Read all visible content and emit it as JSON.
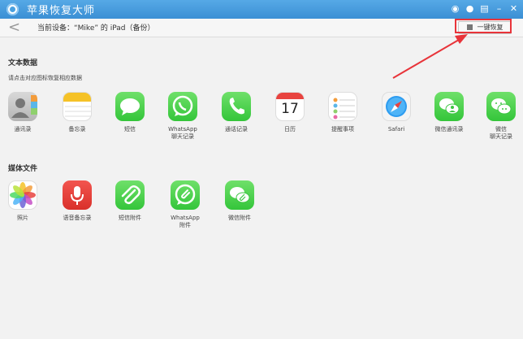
{
  "window": {
    "title": "苹果恢复大师"
  },
  "toolbar": {
    "device": "当前设备：“Mike” 的 iPad（备份）",
    "restore_button": "一键恢复"
  },
  "text_section": {
    "title": "文本数据",
    "hint": "请点击对应图标恢复相应数据",
    "items": [
      {
        "label": "通讯录",
        "icon": "contacts-icon"
      },
      {
        "label": "备忘录",
        "icon": "notes-icon"
      },
      {
        "label": "短信",
        "icon": "messages-icon"
      },
      {
        "label": "WhatsApp\n聊天记录",
        "icon": "whatsapp-icon"
      },
      {
        "label": "通话记录",
        "icon": "phone-icon"
      },
      {
        "label": "日历",
        "icon": "calendar-icon"
      },
      {
        "label": "提醒事项",
        "icon": "reminders-icon"
      },
      {
        "label": "Safari",
        "icon": "safari-icon"
      },
      {
        "label": "微信通讯录",
        "icon": "wechat-contacts-icon"
      },
      {
        "label": "微信\n聊天记录",
        "icon": "wechat-chat-icon"
      }
    ],
    "calendar_day": "17"
  },
  "media_section": {
    "title": "媒体文件",
    "items": [
      {
        "label": "照片",
        "icon": "photos-icon"
      },
      {
        "label": "语音备忘录",
        "icon": "voice-memo-icon"
      },
      {
        "label": "短信附件",
        "icon": "message-attachment-icon"
      },
      {
        "label": "WhatsApp\n附件",
        "icon": "whatsapp-attachment-icon"
      },
      {
        "label": "微信附件",
        "icon": "wechat-attachment-icon"
      }
    ]
  },
  "colors": {
    "titlebar": "#4a9ee0",
    "highlight": "#e8343a",
    "green": "#4cd964"
  }
}
